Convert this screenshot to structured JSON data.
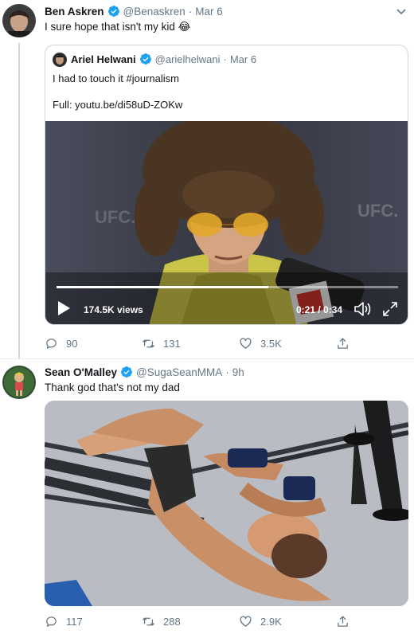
{
  "colors": {
    "verified": "#1da1f2",
    "muted": "#657786",
    "text": "#14171a",
    "border": "#ccd6dd"
  },
  "tweet1": {
    "name": "Ben Askren",
    "handle": "@Benaskren",
    "dot": "·",
    "time": "Mar 6",
    "text": "I sure hope that isn't my kid 😂",
    "quote": {
      "name": "Ariel Helwani",
      "handle": "@arielhelwani",
      "dot": "·",
      "time": "Mar 6",
      "text": "I had to touch it #journalism",
      "link_text": "Full: youtu.be/di58uD-ZOKw",
      "video": {
        "views": "174.5K views",
        "time": "0:21 / 0:34",
        "progress": 0.62,
        "banner_left": "UFC.",
        "banner_right": "UFC."
      }
    },
    "actions": {
      "replies": "90",
      "retweets": "131",
      "likes": "3.5K"
    }
  },
  "tweet2": {
    "name": "Sean O'Malley",
    "handle": "@SugaSeanMMA",
    "dot": "·",
    "time": "9h",
    "text": "Thank god that's not my dad",
    "actions": {
      "replies": "117",
      "retweets": "288",
      "likes": "2.9K"
    }
  },
  "icons": [
    "verified-icon",
    "chevron-down-icon",
    "play-icon",
    "volume-icon",
    "fullscreen-icon",
    "reply-icon",
    "retweet-icon",
    "like-icon",
    "share-icon"
  ]
}
